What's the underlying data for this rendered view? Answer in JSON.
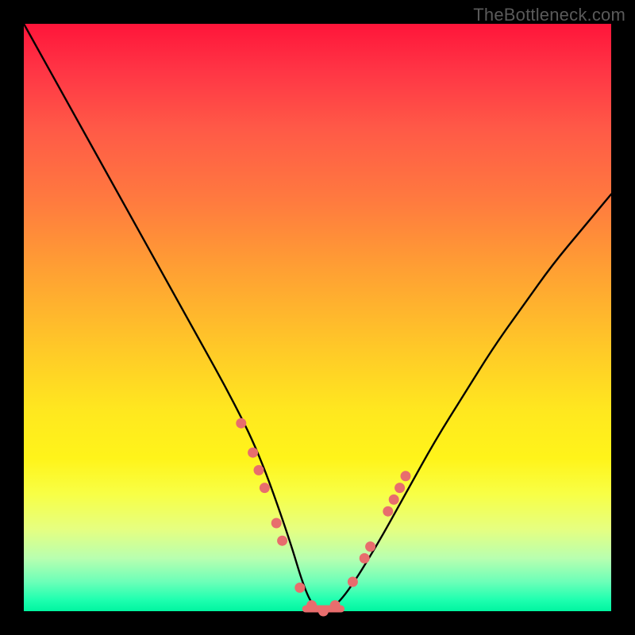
{
  "watermark": "TheBottleneck.com",
  "chart_data": {
    "type": "line",
    "title": "",
    "xlabel": "",
    "ylabel": "",
    "xlim": [
      0,
      100
    ],
    "ylim": [
      0,
      100
    ],
    "series": [
      {
        "name": "bottleneck-curve",
        "x": [
          0,
          5,
          10,
          15,
          20,
          25,
          30,
          35,
          40,
          45,
          48,
          50,
          52,
          55,
          60,
          65,
          70,
          75,
          80,
          85,
          90,
          95,
          100
        ],
        "y": [
          100,
          91,
          82,
          73,
          64,
          55,
          46,
          37,
          27,
          13,
          3,
          0,
          0,
          3,
          11,
          20,
          29,
          37,
          45,
          52,
          59,
          65,
          71
        ]
      }
    ],
    "markers": {
      "name": "highlight-dots",
      "color": "#e86d6d",
      "points": [
        {
          "x": 37,
          "y": 32
        },
        {
          "x": 39,
          "y": 27
        },
        {
          "x": 40,
          "y": 24
        },
        {
          "x": 41,
          "y": 21
        },
        {
          "x": 43,
          "y": 15
        },
        {
          "x": 44,
          "y": 12
        },
        {
          "x": 47,
          "y": 4
        },
        {
          "x": 49,
          "y": 1
        },
        {
          "x": 51,
          "y": 0
        },
        {
          "x": 53,
          "y": 1
        },
        {
          "x": 56,
          "y": 5
        },
        {
          "x": 58,
          "y": 9
        },
        {
          "x": 59,
          "y": 11
        },
        {
          "x": 62,
          "y": 17
        },
        {
          "x": 63,
          "y": 19
        },
        {
          "x": 64,
          "y": 21
        },
        {
          "x": 65,
          "y": 23
        }
      ]
    },
    "flat_bottom_range": [
      48,
      54
    ]
  }
}
